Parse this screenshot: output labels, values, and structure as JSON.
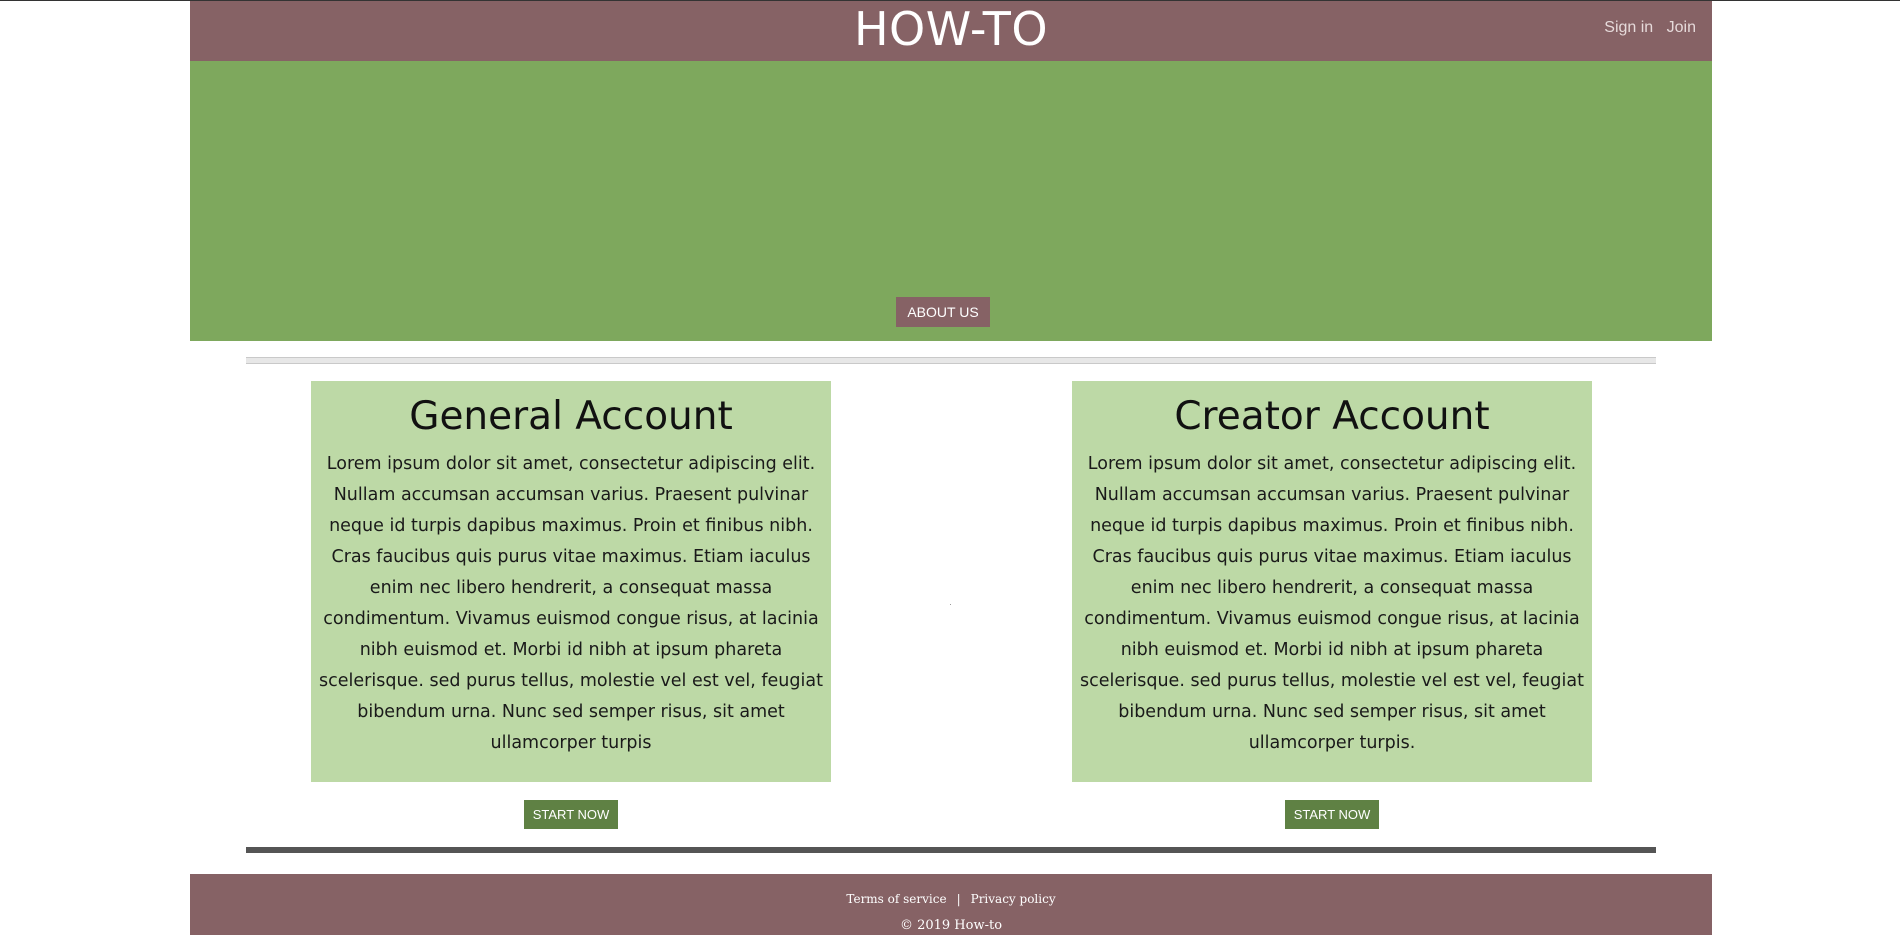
{
  "header": {
    "title": "HOW-TO",
    "sign_in": "Sign in",
    "join": "Join"
  },
  "hero": {
    "about_label": "ABOUT US"
  },
  "cards": {
    "general": {
      "title": "General Account",
      "body": "Lorem ipsum dolor sit amet, consectetur adipiscing elit. Nullam accumsan accumsan varius. Praesent pulvinar neque id turpis dapibus maximus. Proin et finibus nibh. Cras faucibus quis purus vitae maximus. Etiam iaculus enim nec libero hendrerit, a consequat massa condimentum. Vivamus euismod congue risus, at lacinia nibh euismod et. Morbi id nibh at ipsum phareta scelerisque. sed purus tellus, molestie vel est vel, feugiat bibendum urna. Nunc sed semper risus, sit amet ullamcorper turpis",
      "button": "START NOW"
    },
    "creator": {
      "title": "Creator Account",
      "body": "Lorem ipsum dolor sit amet, consectetur adipiscing elit. Nullam accumsan accumsan varius. Praesent pulvinar neque id turpis dapibus maximus. Proin et finibus nibh. Cras faucibus quis purus vitae maximus. Etiam iaculus enim nec libero hendrerit, a consequat massa condimentum. Vivamus euismod congue risus, at lacinia nibh euismod et. Morbi id nibh at ipsum phareta scelerisque. sed purus tellus, molestie vel est vel, feugiat bibendum urna. Nunc sed semper risus, sit amet ullamcorper turpis.",
      "button": "START NOW"
    }
  },
  "footer": {
    "terms": "Terms of service",
    "separator": "|",
    "privacy": "Privacy policy",
    "copyright": "© 2019 How-to"
  },
  "colors": {
    "header_bg": "#866265",
    "hero_bg": "#7ea85d",
    "card_bg": "#bdd9a6",
    "button_green": "#5f8144"
  }
}
